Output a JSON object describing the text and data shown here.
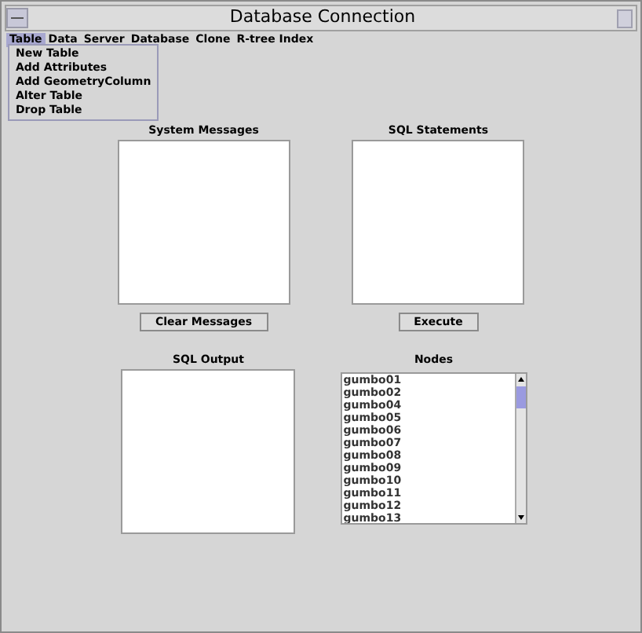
{
  "window": {
    "title": "Database Connection"
  },
  "menu_bar": [
    {
      "label": "Table",
      "selected": true
    },
    {
      "label": "Data",
      "selected": false
    },
    {
      "label": "Server",
      "selected": false
    },
    {
      "label": "Database",
      "selected": false
    },
    {
      "label": "Clone",
      "selected": false
    },
    {
      "label": "R-tree Index",
      "selected": false
    }
  ],
  "dropdown": [
    "New Table",
    "Add Attributes",
    "Add GeometryColumn",
    "Alter Table",
    "Drop Table"
  ],
  "panels": [
    {
      "title": "System Messages",
      "button": "Clear Messages"
    },
    {
      "title": "SQL Statements",
      "button": "Execute"
    }
  ],
  "sql_output": {
    "title": "SQL Output"
  },
  "nodes": {
    "title": "Nodes",
    "items": [
      "gumbo01",
      "gumbo02",
      "gumbo04",
      "gumbo05",
      "gumbo06",
      "gumbo07",
      "gumbo08",
      "gumbo09",
      "gumbo10",
      "gumbo11",
      "gumbo12",
      "gumbo13"
    ]
  }
}
